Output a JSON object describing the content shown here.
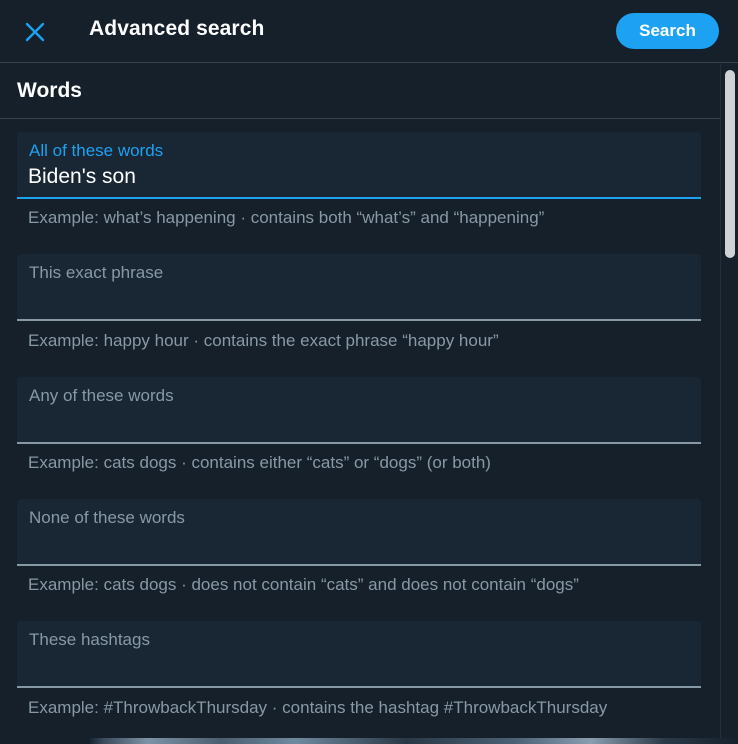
{
  "header": {
    "title": "Advanced search",
    "close_icon": "close-icon",
    "search_label": "Search"
  },
  "colors": {
    "accent": "#1da1f2",
    "background": "#15202b",
    "field_background": "#192734",
    "muted_text": "#8899a6"
  },
  "section": {
    "title": "Words"
  },
  "fields": [
    {
      "label": "All of these words",
      "value": "Biden's son",
      "hint": "Example: what’s happening · contains both “what’s” and “happening”"
    },
    {
      "label": "This exact phrase",
      "value": "",
      "hint": "Example: happy hour · contains the exact phrase “happy hour”"
    },
    {
      "label": "Any of these words",
      "value": "",
      "hint": "Example: cats dogs · contains either “cats” or “dogs” (or both)"
    },
    {
      "label": "None of these words",
      "value": "",
      "hint": "Example: cats dogs · does not contain “cats” and does not contain “dogs”"
    },
    {
      "label": "These hashtags",
      "value": "",
      "hint": "Example: #ThrowbackThursday · contains the hashtag #ThrowbackThursday"
    }
  ]
}
